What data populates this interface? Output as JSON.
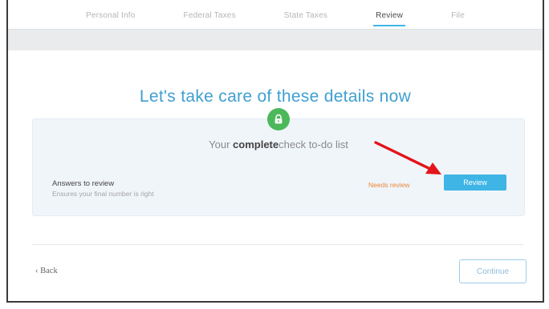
{
  "steps": [
    {
      "label": "Personal Info",
      "active": false
    },
    {
      "label": "Federal Taxes",
      "active": false
    },
    {
      "label": "State Taxes",
      "active": false
    },
    {
      "label": "Review",
      "active": true
    },
    {
      "label": "File",
      "active": false
    }
  ],
  "main": {
    "heading": "Let's take care of these details now",
    "subtitle_prefix": "Your ",
    "subtitle_bold": "complete",
    "subtitle_suffix": "check to-do list",
    "status_icon": "lock-icon"
  },
  "review_item": {
    "title": "Answers to review",
    "description": "Ensures your final number is right",
    "status": "Needs review",
    "button_label": "Review"
  },
  "footer": {
    "back_label": "‹ Back",
    "continue_label": "Continue"
  },
  "colors": {
    "accent": "#3fb5e6",
    "heading": "#3f9fd1",
    "success": "#4bb85a",
    "warning": "#e8893a",
    "annotation_arrow": "#e3141b"
  }
}
